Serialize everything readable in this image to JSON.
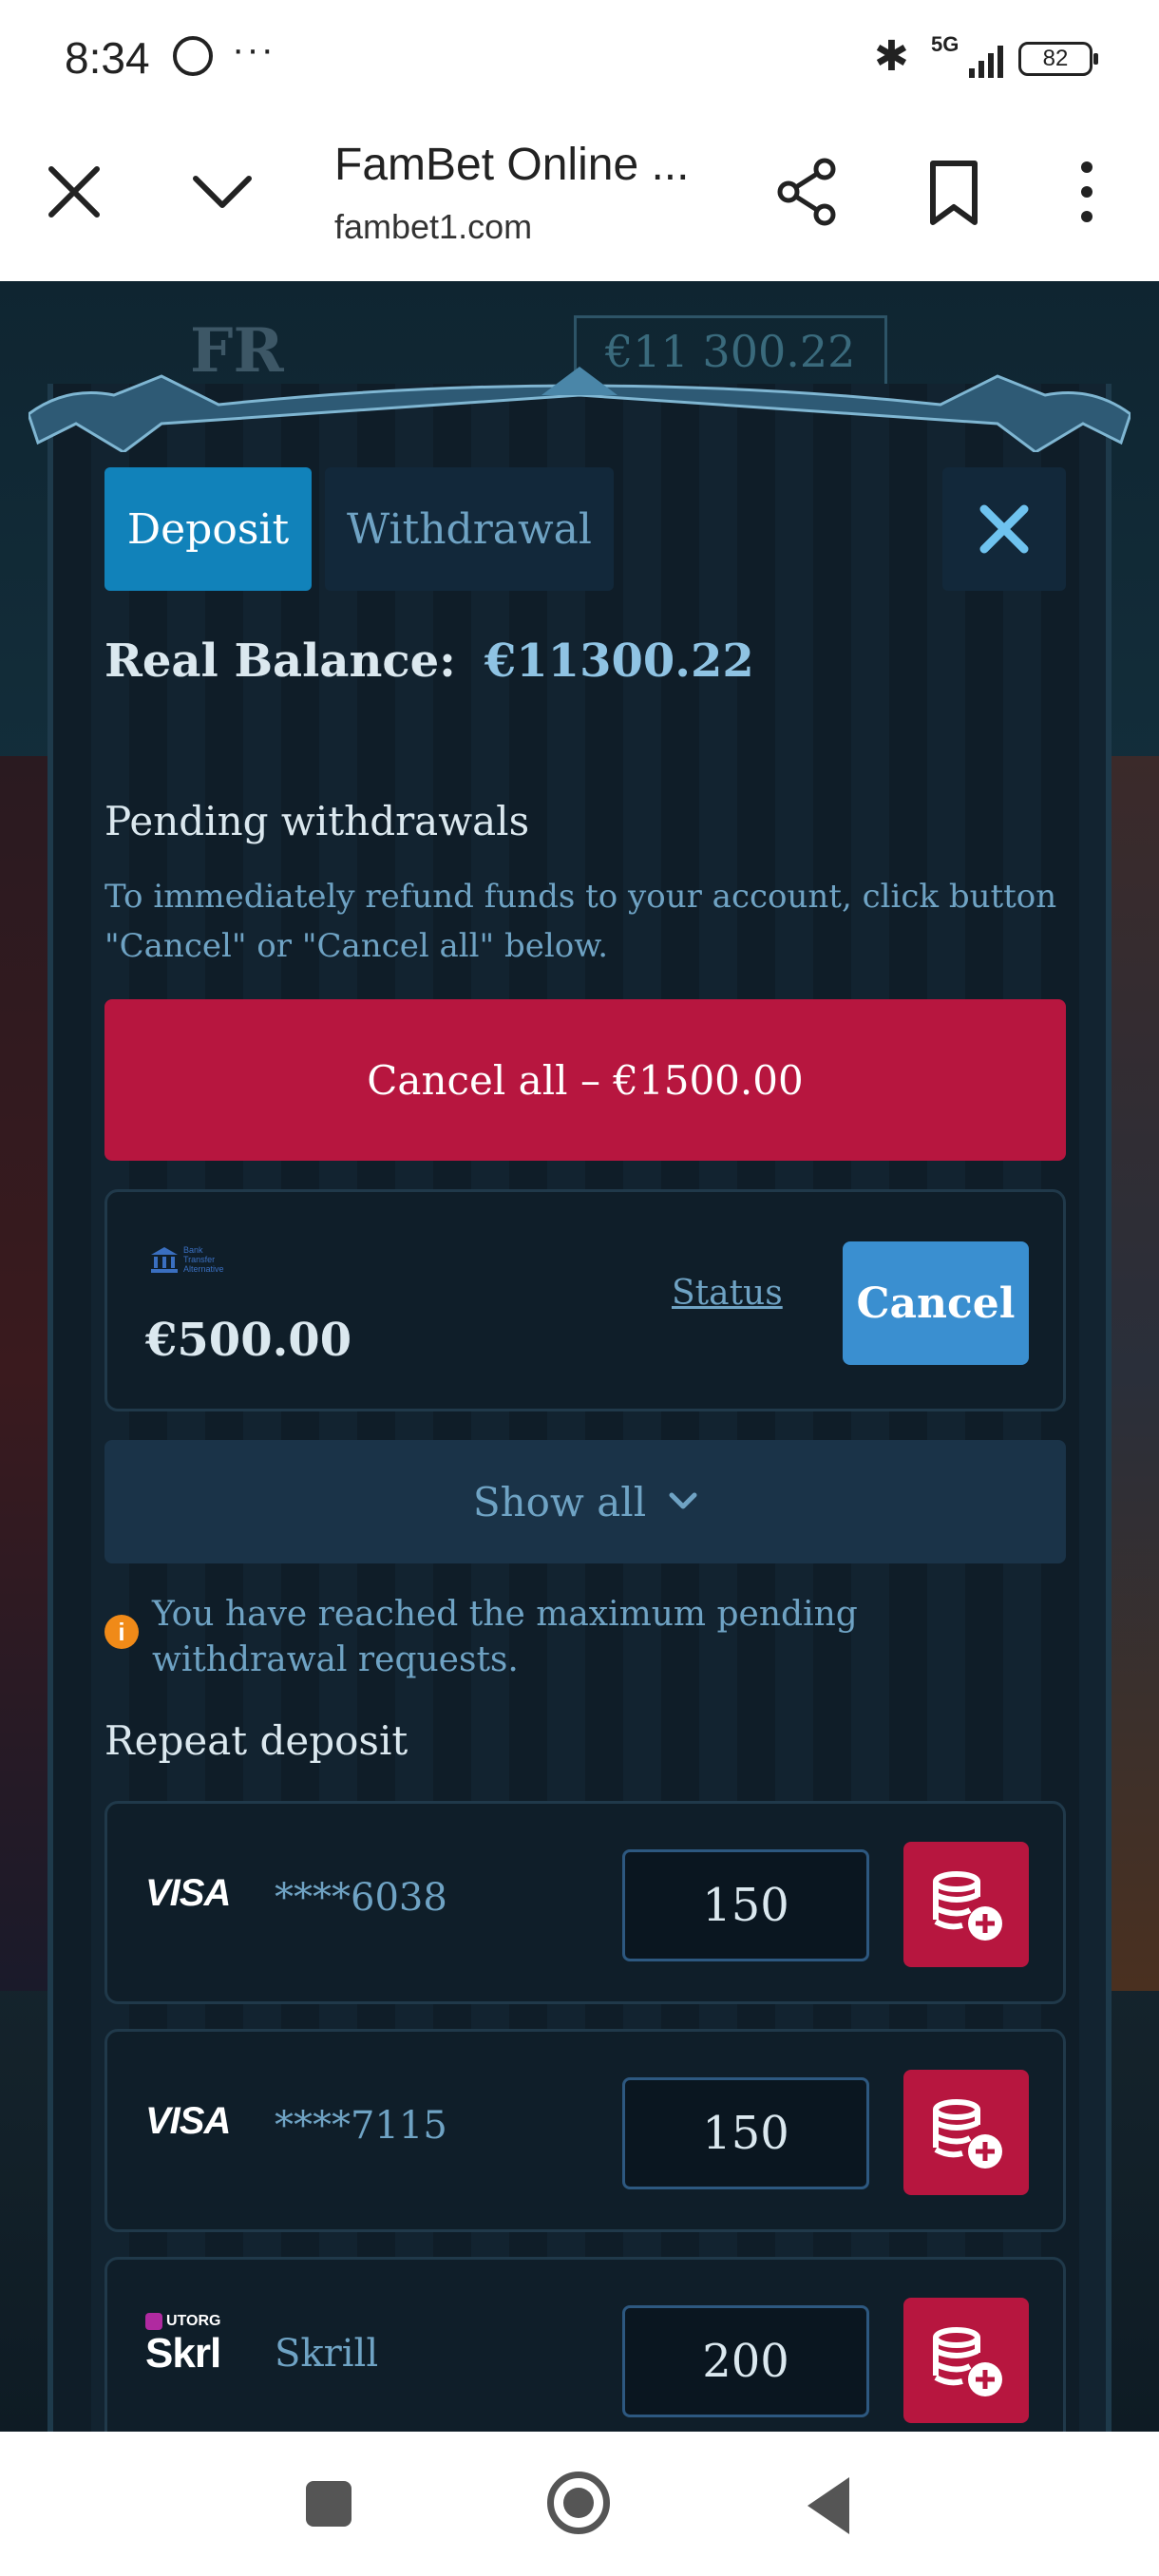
{
  "status_bar": {
    "time": "8:34",
    "overflow": "···",
    "network": "5G",
    "battery": "82"
  },
  "browser": {
    "title": "FamBet Online ...",
    "url": "fambet1.com"
  },
  "page_background": {
    "logo_peek": "FR",
    "balance_peek": "€11 300.22"
  },
  "modal": {
    "tabs": {
      "deposit": "Deposit",
      "withdrawal": "Withdrawal"
    },
    "balance_label": "Real Balance:",
    "balance_value": "€11300.22",
    "pending_title": "Pending withdrawals",
    "pending_hint": "To immediately refund funds to your account, click button \"Cancel\" or \"Cancel all\" below.",
    "cancel_all_label": "Cancel all – €1500.00",
    "pending_item": {
      "method_lines": [
        "Bank",
        "Transfer",
        "Alternative"
      ],
      "amount": "€500.00",
      "status_label": "Status",
      "cancel_label": "Cancel"
    },
    "show_all_label": "Show all",
    "warning_text": "You have reached the maximum pending withdrawal requests.",
    "repeat_title": "Repeat deposit",
    "repeat_deposits": [
      {
        "brand": "VISA",
        "sub": "",
        "card": "****6038",
        "amount": "150"
      },
      {
        "brand": "VISA",
        "sub": "",
        "card": "****7115",
        "amount": "150"
      },
      {
        "brand": "Skrl",
        "sub": "UTORG",
        "card": "Skrill",
        "amount": "200"
      }
    ]
  },
  "colors": {
    "accent_blue": "#1182ba",
    "danger_red": "#b7163f",
    "text_muted_blue": "#6fa3c4",
    "warning_orange": "#f08a18"
  },
  "icons": [
    "close-icon",
    "chevron-down-icon",
    "share-icon",
    "bookmark-icon",
    "more-vert-icon",
    "bank-icon",
    "info-icon",
    "coins-add-icon"
  ]
}
